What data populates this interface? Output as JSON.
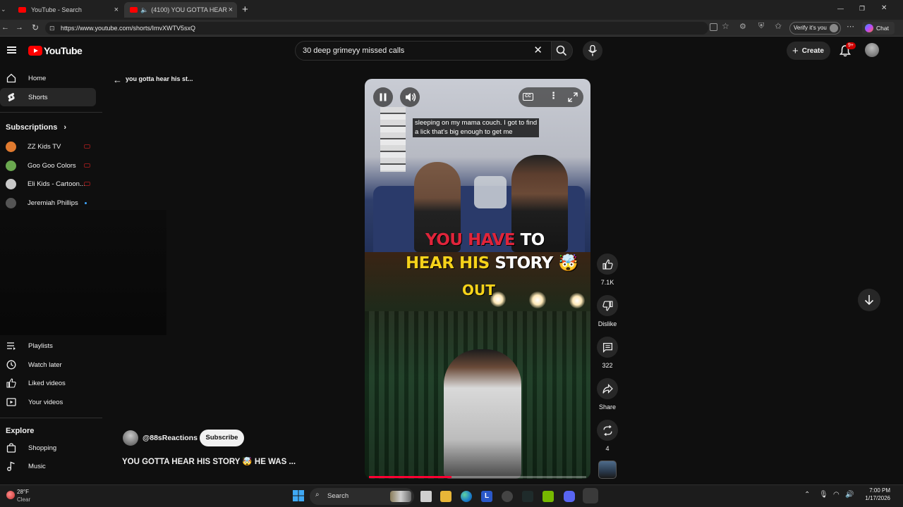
{
  "browser": {
    "tabs": [
      {
        "title": "YouTube - Search",
        "active": false
      },
      {
        "title": "(4100) YOU GOTTA HEAR HIS",
        "active": true
      }
    ],
    "new_tab": "+",
    "url": "https://www.youtube.com/shorts/ImvXWTV5sxQ",
    "verify_label": "Verify it's you",
    "chat_label": "Chat",
    "window_controls": [
      "—",
      "❐",
      "✕"
    ]
  },
  "header": {
    "logo_text": "YouTube",
    "search_value": "30 deep grimeyy missed calls",
    "create_label": "Create",
    "notification_badge": "9+"
  },
  "sidebar": {
    "main": [
      {
        "label": "Home",
        "icon": "home-icon"
      },
      {
        "label": "Shorts",
        "icon": "shorts-icon",
        "active": true
      }
    ],
    "subscriptions_heading": "Subscriptions",
    "subscriptions": [
      {
        "label": "ZZ Kids TV",
        "color": "#e07a2f",
        "live": true
      },
      {
        "label": "Goo Goo Colors",
        "color": "#6aa84f",
        "live": true
      },
      {
        "label": "Eli Kids - Cartoon...",
        "color": "#c9c9c9",
        "live": true
      },
      {
        "label": "Jeremiah Phillips",
        "color": "#555555",
        "live": false
      }
    ],
    "you_items": [
      {
        "label": "Playlists",
        "icon": "playlists-icon"
      },
      {
        "label": "Watch later",
        "icon": "clock-icon"
      },
      {
        "label": "Liked videos",
        "icon": "thumbs-up-icon"
      },
      {
        "label": "Your videos",
        "icon": "video-icon"
      }
    ],
    "explore_heading": "Explore",
    "explore_items": [
      {
        "label": "Shopping",
        "icon": "shopping-bag-icon"
      },
      {
        "label": "Music",
        "icon": "music-icon"
      }
    ]
  },
  "shorts": {
    "back_title": "you gotta hear his st...",
    "channel_handle": "@88sReactions",
    "subscribe_label": "Subscribe",
    "video_title": "YOU GOTTA HEAR HIS STORY 🤯 HE WAS ...",
    "caption_line1": "sleeping on my mama couch. I got to find",
    "caption_line2": "a lick that's big enough to get me",
    "overlay_line1_red": "YOU HAVE",
    "overlay_line1_white": "TO",
    "overlay_line2_red": "HEAR HIS",
    "overlay_line2_white": "STORY 🤯",
    "overlay_line3": "OUT",
    "cc_label": "CC",
    "progress_fraction": 0.38,
    "actions": {
      "likes": "7.1K",
      "dislike_label": "Dislike",
      "comments": "322",
      "share_label": "Share",
      "remix_count": "4"
    }
  },
  "taskbar": {
    "weather_temp": "28°F",
    "weather_desc": "Clear",
    "search_label": "Search",
    "time": "7:00 PM",
    "date": "1/17/2026"
  },
  "colors": {
    "accent_red": "#ff0000",
    "caption_red": "#e0243a",
    "caption_yellow": "#f5d21a"
  }
}
